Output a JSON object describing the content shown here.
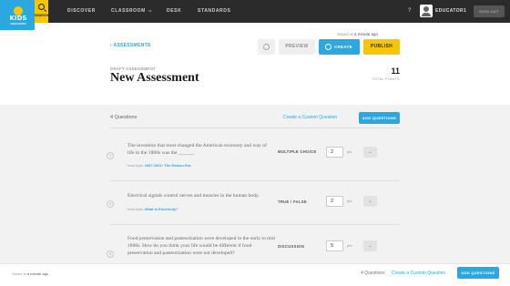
{
  "nav": {
    "logo_text": "KIDS",
    "logo_sub": "DISCOVER",
    "search_label": "SEARCH",
    "items": [
      {
        "label": "DISCOVER"
      },
      {
        "label": "CLASSROOM"
      },
      {
        "label": "DESK"
      },
      {
        "label": "STANDARDS"
      }
    ],
    "help": "?",
    "username": "EDUCATOR1",
    "signout": "SIGN OUT"
  },
  "header": {
    "saved_prefix": "Saved at",
    "saved_time": "a minute ago",
    "back_link": "ASSESSMENTS",
    "preview": "PREVIEW",
    "create_pdf": "CREATE PDF",
    "publish": "PUBLISH",
    "draft_label": "DRAFT ASSESSMENT",
    "title": "New Assessment",
    "total_points": "11",
    "total_points_label": "TOTAL POINTS"
  },
  "questions_header": {
    "count": "4 Questions",
    "create_custom": "Create a Custom Question",
    "add_questions": "ADD QUESTIONS"
  },
  "questions": [
    {
      "number": "1",
      "text": "The invention that most changed the American economy and way of life in the 1800s was the ______.",
      "source_prefix": "from topic",
      "source_link": "1667-1921: The Edison Era",
      "type": "MULTIPLE CHOICE",
      "points": "2",
      "points_unit": "pts"
    },
    {
      "number": "2",
      "text": "Electrical signals control nerves and muscles in the human body.",
      "source_prefix": "from topic",
      "source_link": "What is Electricity?",
      "type": "TRUE / FALSE",
      "points": "2",
      "points_unit": "pts"
    },
    {
      "number": "3",
      "text": "Food preservation and pasteurization were developed in the early to mid 1800s. How do you think your life would be different if food preservation and pasteurization were not developed?",
      "type": "DISCUSSION",
      "points": "5",
      "points_unit": "pts"
    }
  ],
  "footer": {
    "saved_prefix": "Saved at",
    "saved_time": "a minute ago",
    "count": "4 Questions",
    "create_custom": "Create a Custom Question",
    "add_questions": "ADD QUESTIONS"
  },
  "colors": {
    "accent_blue": "#2aa8df",
    "accent_yellow": "#f7c600",
    "nav_bg": "#2b2b2b"
  }
}
